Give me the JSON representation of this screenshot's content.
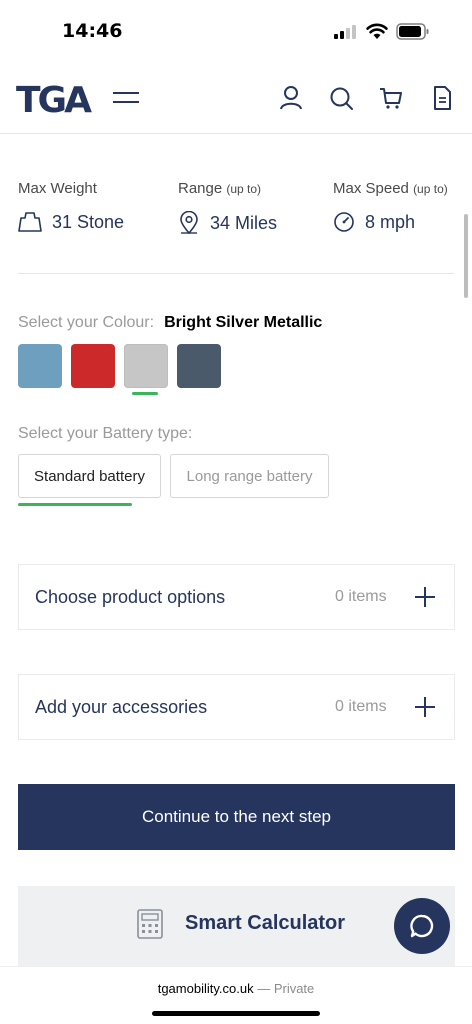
{
  "status_bar": {
    "time": "14:46"
  },
  "header": {
    "logo": "TGA",
    "icons": [
      "menu-icon",
      "user-icon",
      "search-icon",
      "cart-icon",
      "document-icon"
    ]
  },
  "specs": {
    "max_weight": {
      "label": "Max Weight",
      "value": "31 Stone",
      "icon": "weight-icon"
    },
    "range": {
      "label": "Range",
      "qualifier": "(up to)",
      "value": "34 Miles",
      "icon": "location-pin-icon"
    },
    "max_speed": {
      "label": "Max Speed",
      "qualifier": "(up to)",
      "value": "8 mph",
      "icon": "speedometer-icon"
    }
  },
  "colour": {
    "label": "Select your Colour:",
    "selected": "Bright Silver Metallic",
    "selected_index": 2,
    "swatches": [
      "#6e9fbf",
      "#cc2a2a",
      "#c6c6c6",
      "#4b5a6a"
    ]
  },
  "battery": {
    "label": "Select your Battery type:",
    "options": [
      "Standard battery",
      "Long range battery"
    ],
    "selected_index": 0
  },
  "options": [
    {
      "title": "Choose product options",
      "count": "0 items"
    },
    {
      "title": "Add your accessories",
      "count": "0 items"
    }
  ],
  "continue_label": "Continue to the next step",
  "calculator": {
    "title": "Smart Calculator",
    "icon": "calculator-icon"
  },
  "chat_icon": "chat-icon",
  "browser": {
    "domain": "tgamobility.co.uk",
    "mode": "— Private"
  },
  "colors": {
    "brand_navy": "#26355e",
    "accent_green": "#3bb55a"
  }
}
